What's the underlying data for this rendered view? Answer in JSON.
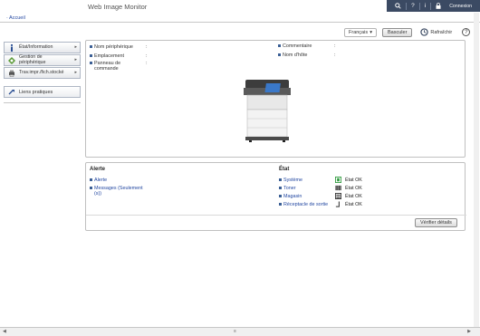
{
  "header": {
    "title": "Web Image Monitor",
    "login": "Connexion"
  },
  "breadcrumb": {
    "home": "· Accueil"
  },
  "sidebar": {
    "items": [
      {
        "label": "État/Information"
      },
      {
        "label": "Gestion de\npériphérique"
      },
      {
        "label": "Trav.impr./fich.stocké"
      }
    ],
    "links_label": "Liens pratiques"
  },
  "toolbar": {
    "language_value": "Français",
    "switch_label": "Basculer",
    "refresh_label": "Rafraîchir"
  },
  "device_info": {
    "left": [
      {
        "label": "Nom périphérique",
        "value": ""
      },
      {
        "label": "Emplacement",
        "value": ""
      },
      {
        "label": "Panneau de\ncommande",
        "value": ""
      }
    ],
    "right": [
      {
        "label": "Commentaire",
        "value": ""
      },
      {
        "label": "Nom d'hôte",
        "value": ""
      }
    ]
  },
  "alert": {
    "title": "Alerte",
    "items": [
      "Alerte",
      "Messages (Seulement\n(s))"
    ]
  },
  "status": {
    "title": "État",
    "items": [
      {
        "label": "Système",
        "value": "État OK",
        "icon": "system-icon"
      },
      {
        "label": "Toner",
        "value": "État OK",
        "icon": "toner-icon"
      },
      {
        "label": "Magasin",
        "value": "État OK",
        "icon": "tray-icon"
      },
      {
        "label": "Réceptacle de sortie",
        "value": "État OK",
        "icon": "output-tray-icon"
      }
    ],
    "details_button": "Vérifier détails"
  },
  "colors": {
    "header_bar": "#3b4a63",
    "link": "#2247a1",
    "ok_green": "#2e9a3d"
  }
}
